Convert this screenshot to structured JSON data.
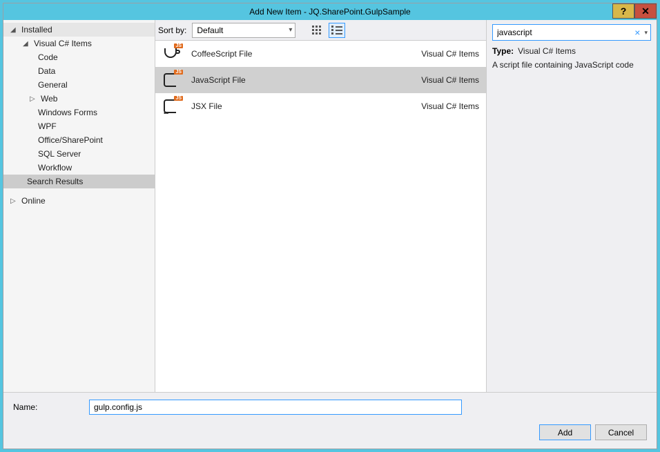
{
  "title": "Add New Item - JQ.SharePoint.GulpSample",
  "sidebar": {
    "installed": "Installed",
    "online": "Online",
    "group_main": "Visual C# Items",
    "items": [
      "Code",
      "Data",
      "General",
      "Web",
      "Windows Forms",
      "WPF",
      "Office/SharePoint",
      "SQL Server",
      "Workflow",
      "Search Results"
    ]
  },
  "toolbar": {
    "sort_label": "Sort by:",
    "sort_value": "Default"
  },
  "templates": [
    {
      "name": "CoffeeScript File",
      "category": "Visual C# Items"
    },
    {
      "name": "JavaScript File",
      "category": "Visual C# Items"
    },
    {
      "name": "JSX File",
      "category": "Visual C# Items"
    }
  ],
  "search": {
    "value": "javascript"
  },
  "details": {
    "type_label": "Type:",
    "type_value": "Visual C# Items",
    "description": "A script file containing JavaScript code"
  },
  "footer": {
    "name_label": "Name:",
    "name_value": "gulp.config.js",
    "add": "Add",
    "cancel": "Cancel"
  }
}
